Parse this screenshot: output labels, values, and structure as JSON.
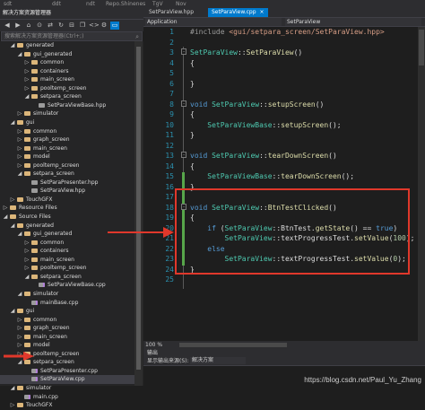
{
  "top_strip": [
    "sdt",
    "ddt",
    "ndt",
    "Repo.Shinenes",
    "TgV",
    "Nov"
  ],
  "solution_explorer": {
    "title": "解决方案资源管理器",
    "toolbar_icons": [
      "back-icon",
      "forward-icon",
      "home-icon",
      "pending-icon",
      "sync-icon",
      "refresh-icon",
      "collapse-icon",
      "showall-icon",
      "code-icon",
      "settings-icon",
      "preview-icon"
    ],
    "search_placeholder": "搜索解决方案资源管理器(Ctrl+;)",
    "tree": [
      {
        "label": "generated",
        "indent": 2,
        "type": "folder",
        "expanded": true
      },
      {
        "label": "gui_generated",
        "indent": 3,
        "type": "folder",
        "expanded": true
      },
      {
        "label": "common",
        "indent": 4,
        "type": "folder",
        "expanded": false
      },
      {
        "label": "containers",
        "indent": 4,
        "type": "folder",
        "expanded": false
      },
      {
        "label": "main_screen",
        "indent": 4,
        "type": "folder",
        "expanded": false
      },
      {
        "label": "pooltemp_screen",
        "indent": 4,
        "type": "folder",
        "expanded": false
      },
      {
        "label": "setpara_screen",
        "indent": 4,
        "type": "folder",
        "expanded": true
      },
      {
        "label": "SetParaViewBase.hpp",
        "indent": 5,
        "type": "file"
      },
      {
        "label": "simulator",
        "indent": 3,
        "type": "folder",
        "expanded": false
      },
      {
        "label": "gui",
        "indent": 2,
        "type": "folder",
        "expanded": true
      },
      {
        "label": "common",
        "indent": 3,
        "type": "folder",
        "expanded": false
      },
      {
        "label": "graph_screen",
        "indent": 3,
        "type": "folder",
        "expanded": false
      },
      {
        "label": "main_screen",
        "indent": 3,
        "type": "folder",
        "expanded": false
      },
      {
        "label": "model",
        "indent": 3,
        "type": "folder",
        "expanded": false
      },
      {
        "label": "pooltemp_screen",
        "indent": 3,
        "type": "folder",
        "expanded": false
      },
      {
        "label": "setpara_screen",
        "indent": 3,
        "type": "folder",
        "expanded": true
      },
      {
        "label": "SetParaPresenter.hpp",
        "indent": 4,
        "type": "file"
      },
      {
        "label": "SetParaView.hpp",
        "indent": 4,
        "type": "file"
      },
      {
        "label": "TouchGFX",
        "indent": 2,
        "type": "folder",
        "expanded": false
      },
      {
        "label": "Resource Files",
        "indent": 1,
        "type": "folder",
        "expanded": false
      },
      {
        "label": "Source Files",
        "indent": 1,
        "type": "folder",
        "expanded": true
      },
      {
        "label": "generated",
        "indent": 2,
        "type": "folder",
        "expanded": true
      },
      {
        "label": "gui_generated",
        "indent": 3,
        "type": "folder",
        "expanded": true
      },
      {
        "label": "common",
        "indent": 4,
        "type": "folder",
        "expanded": false
      },
      {
        "label": "containers",
        "indent": 4,
        "type": "folder",
        "expanded": false
      },
      {
        "label": "main_screen",
        "indent": 4,
        "type": "folder",
        "expanded": false
      },
      {
        "label": "pooltemp_screen",
        "indent": 4,
        "type": "folder",
        "expanded": false
      },
      {
        "label": "setpara_screen",
        "indent": 4,
        "type": "folder",
        "expanded": true
      },
      {
        "label": "SetParaViewBase.cpp",
        "indent": 5,
        "type": "cpp"
      },
      {
        "label": "simulator",
        "indent": 3,
        "type": "folder",
        "expanded": true
      },
      {
        "label": "mainBase.cpp",
        "indent": 4,
        "type": "cpp"
      },
      {
        "label": "gui",
        "indent": 2,
        "type": "folder",
        "expanded": true
      },
      {
        "label": "common",
        "indent": 3,
        "type": "folder",
        "expanded": false
      },
      {
        "label": "graph_screen",
        "indent": 3,
        "type": "folder",
        "expanded": false
      },
      {
        "label": "main_screen",
        "indent": 3,
        "type": "folder",
        "expanded": false
      },
      {
        "label": "model",
        "indent": 3,
        "type": "folder",
        "expanded": false
      },
      {
        "label": "pooltemp_screen",
        "indent": 3,
        "type": "folder",
        "expanded": false
      },
      {
        "label": "setpara_screen",
        "indent": 3,
        "type": "folder",
        "expanded": true
      },
      {
        "label": "SetParaPresenter.cpp",
        "indent": 4,
        "type": "cpp"
      },
      {
        "label": "SetParaView.cpp",
        "indent": 4,
        "type": "cpp",
        "selected": true
      },
      {
        "label": "simulator",
        "indent": 2,
        "type": "folder",
        "expanded": true
      },
      {
        "label": "main.cpp",
        "indent": 3,
        "type": "cpp"
      },
      {
        "label": "TouchGFX",
        "indent": 2,
        "type": "folder",
        "expanded": false
      }
    ]
  },
  "editor": {
    "tabs": [
      {
        "label": "SetParaView.hpp",
        "active": false
      },
      {
        "label": "SetParaView.cpp",
        "active": true
      }
    ],
    "close_glyph": "×",
    "scope_left": "Application",
    "scope_right": "SetParaView",
    "zoom": "100 %",
    "lines": [
      {
        "n": "1",
        "tokens": [
          [
            "pp",
            "#include "
          ],
          [
            "st",
            "<gui/setpara_screen/SetParaView.hpp>"
          ]
        ]
      },
      {
        "n": "2",
        "tokens": []
      },
      {
        "n": "3",
        "fold": "-",
        "tokens": [
          [
            "ty",
            "SetParaView"
          ],
          [
            "pl",
            "::"
          ],
          [
            "fn",
            "SetParaView"
          ],
          [
            "pl",
            "()"
          ]
        ]
      },
      {
        "n": "4",
        "tokens": [
          [
            "pl",
            "{"
          ]
        ]
      },
      {
        "n": "5",
        "tokens": []
      },
      {
        "n": "6",
        "tokens": [
          [
            "pl",
            "}"
          ]
        ]
      },
      {
        "n": "7",
        "tokens": []
      },
      {
        "n": "8",
        "fold": "-",
        "tokens": [
          [
            "kw",
            "void "
          ],
          [
            "ty",
            "SetParaView"
          ],
          [
            "pl",
            "::"
          ],
          [
            "fn",
            "setupScreen"
          ],
          [
            "pl",
            "()"
          ]
        ]
      },
      {
        "n": "9",
        "tokens": [
          [
            "pl",
            "{"
          ]
        ]
      },
      {
        "n": "10",
        "tokens": [
          [
            "pl",
            "    "
          ],
          [
            "ty",
            "SetParaViewBase"
          ],
          [
            "pl",
            "::"
          ],
          [
            "fn",
            "setupScreen"
          ],
          [
            "pl",
            "();"
          ]
        ]
      },
      {
        "n": "11",
        "tokens": [
          [
            "pl",
            "}"
          ]
        ]
      },
      {
        "n": "12",
        "tokens": []
      },
      {
        "n": "13",
        "fold": "-",
        "tokens": [
          [
            "kw",
            "void "
          ],
          [
            "ty",
            "SetParaView"
          ],
          [
            "pl",
            "::"
          ],
          [
            "fn",
            "tearDownScreen"
          ],
          [
            "pl",
            "()"
          ]
        ]
      },
      {
        "n": "14",
        "tokens": [
          [
            "pl",
            "{"
          ]
        ]
      },
      {
        "n": "15",
        "tokens": [
          [
            "pl",
            "    "
          ],
          [
            "ty",
            "SetParaViewBase"
          ],
          [
            "pl",
            "::"
          ],
          [
            "fn",
            "tearDownScreen"
          ],
          [
            "pl",
            "();"
          ]
        ]
      },
      {
        "n": "16",
        "tokens": [
          [
            "pl",
            "}"
          ]
        ]
      },
      {
        "n": "17",
        "tokens": []
      },
      {
        "n": "18",
        "fold": "-",
        "tokens": [
          [
            "kw",
            "void "
          ],
          [
            "ty",
            "SetParaView"
          ],
          [
            "pl",
            "::"
          ],
          [
            "fn",
            "BtnTestClicked"
          ],
          [
            "pl",
            "()"
          ]
        ]
      },
      {
        "n": "19",
        "tokens": [
          [
            "pl",
            "{"
          ]
        ]
      },
      {
        "n": "20",
        "tokens": [
          [
            "pl",
            "    "
          ],
          [
            "kw",
            "if "
          ],
          [
            "pl",
            "("
          ],
          [
            "ty",
            "SetParaView"
          ],
          [
            "pl",
            "::BtnTest."
          ],
          [
            "fn",
            "getState"
          ],
          [
            "pl",
            "() == "
          ],
          [
            "kw",
            "true"
          ],
          [
            "pl",
            ")"
          ]
        ]
      },
      {
        "n": "21",
        "tokens": [
          [
            "pl",
            "        "
          ],
          [
            "ty",
            "SetParaView"
          ],
          [
            "pl",
            "::textProgressTest."
          ],
          [
            "fn",
            "setValue"
          ],
          [
            "pl",
            "("
          ],
          [
            "nm",
            "100"
          ],
          [
            "pl",
            ");"
          ]
        ]
      },
      {
        "n": "22",
        "tokens": [
          [
            "pl",
            "    "
          ],
          [
            "kw",
            "else"
          ]
        ]
      },
      {
        "n": "23",
        "tokens": [
          [
            "pl",
            "        "
          ],
          [
            "ty",
            "SetParaView"
          ],
          [
            "pl",
            "::textProgressTest."
          ],
          [
            "fn",
            "setValue"
          ],
          [
            "pl",
            "("
          ],
          [
            "nm",
            "0"
          ],
          [
            "pl",
            ");"
          ]
        ]
      },
      {
        "n": "24",
        "tokens": [
          [
            "pl",
            "}"
          ]
        ]
      },
      {
        "n": "25",
        "tokens": []
      }
    ]
  },
  "output": {
    "title": "输出",
    "show_output_from": "显示输出来源(S):",
    "source": "解决方案"
  },
  "watermark": "https://blog.csdn.net/Paul_Yu_Zhang",
  "colors": {
    "accent": "#007acc",
    "highlight_box": "#e0382b",
    "arrow": "#e0382b",
    "change_bar": "#57a64a"
  }
}
